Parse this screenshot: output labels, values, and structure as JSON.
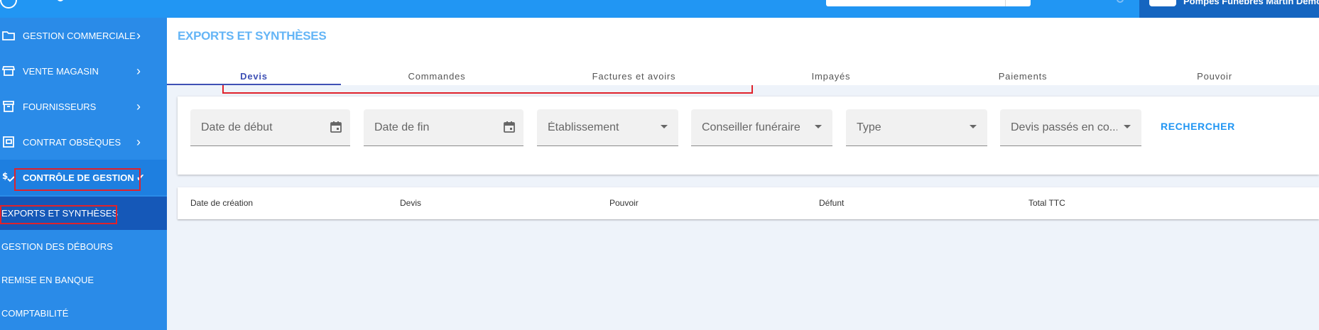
{
  "topbar": {
    "account_name": "Pompes Funèbres Martin Démo"
  },
  "sidebar": {
    "items": [
      {
        "label": "GESTION COMMERCIALE",
        "icon": "folder-icon"
      },
      {
        "label": "VENTE MAGASIN",
        "icon": "store-icon"
      },
      {
        "label": "FOURNISSEURS",
        "icon": "archive-icon"
      },
      {
        "label": "CONTRAT OBSÈQUES",
        "icon": "contract-icon"
      },
      {
        "label": "CONTRÔLE DE GESTION",
        "icon": "dollar-check-icon"
      }
    ],
    "sub_items": [
      {
        "label": "EXPORTS ET SYNTHÈSES"
      },
      {
        "label": "GESTION DES DÉBOURS"
      },
      {
        "label": "REMISE EN BANQUE"
      },
      {
        "label": "COMPTABILITÉ"
      }
    ]
  },
  "main": {
    "title": "EXPORTS ET SYNTHÈSES",
    "tabs": [
      {
        "label": "Devis"
      },
      {
        "label": "Commandes"
      },
      {
        "label": "Factures et avoirs"
      },
      {
        "label": "Impayés"
      },
      {
        "label": "Paiements"
      },
      {
        "label": "Pouvoir"
      }
    ],
    "active_tab": "Devis"
  },
  "filters": {
    "start_date": "Date de début",
    "end_date": "Date de fin",
    "establishment": "Établissement",
    "advisor": "Conseiller funéraire",
    "type": "Type",
    "quotes_passed": "Devis passés en co...",
    "search_label": "RECHERCHER"
  },
  "table": {
    "columns": [
      "Date de création",
      "Devis",
      "Pouvoir",
      "Défunt",
      "Total TTC"
    ]
  },
  "colors": {
    "topbar": "#2196f3",
    "sidebar": "#2a8be8",
    "sidebar_selected": "#1558b8",
    "accent": "#3f51b5",
    "highlight_box": "#e0222b"
  }
}
